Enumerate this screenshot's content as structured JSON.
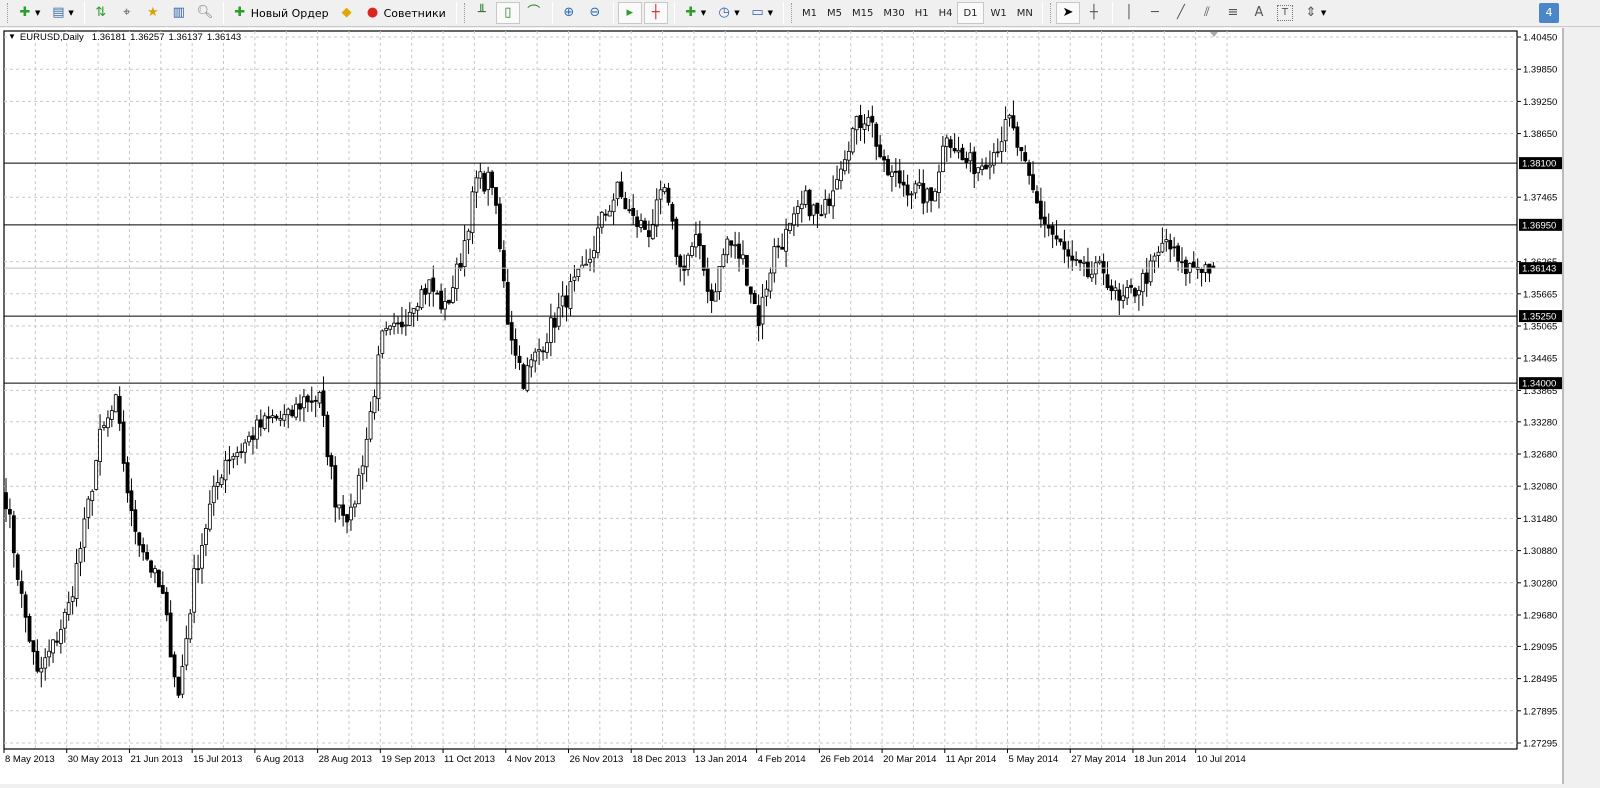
{
  "toolbar": {
    "new_order_label": "Новый Ордер",
    "experts_label": "Советники",
    "timeframes": [
      "M1",
      "M5",
      "M15",
      "M30",
      "H1",
      "H4",
      "D1",
      "W1",
      "MN"
    ],
    "active_timeframe": "D1",
    "notification_count": "4",
    "text_tool_label": "A"
  },
  "chart": {
    "symbol": "EURUSD,Daily",
    "open": "1.36181",
    "high": "1.36257",
    "low": "1.36137",
    "close": "1.36143",
    "bull_color": "#ffffff",
    "bear_color": "#000000",
    "outline_color": "#000000"
  },
  "chart_data": {
    "type": "candlestick",
    "price_ticks": [
      "1.40450",
      "1.39850",
      "1.39250",
      "1.38650",
      "1.37465",
      "1.36265",
      "1.35665",
      "1.35065",
      "1.34465",
      "1.33865",
      "1.33280",
      "1.32680",
      "1.32080",
      "1.31480",
      "1.30880",
      "1.30280",
      "1.29680",
      "1.29095",
      "1.28495",
      "1.27895",
      "1.27295"
    ],
    "ylim": [
      1.27295,
      1.4045
    ],
    "date_ticks": [
      "8 May 2013",
      "30 May 2013",
      "21 Jun 2013",
      "15 Jul 2013",
      "6 Aug 2013",
      "28 Aug 2013",
      "19 Sep 2013",
      "11 Oct 2013",
      "4 Nov 2013",
      "26 Nov 2013",
      "18 Dec 2013",
      "13 Jan 2014",
      "4 Feb 2014",
      "26 Feb 2014",
      "20 Mar 2014",
      "11 Apr 2014",
      "5 May 2014",
      "27 May 2014",
      "18 Jun 2014",
      "10 Jul 2014"
    ],
    "bars_between_date_ticks": 16,
    "approx_close_every_4_bars": [
      1.3186,
      1.2999,
      1.2853,
      1.2909,
      1.2983,
      1.313,
      1.3297,
      1.3362,
      1.3149,
      1.3075,
      1.2999,
      1.2816,
      1.3038,
      1.3168,
      1.326,
      1.3278,
      1.3315,
      1.3334,
      1.3334,
      1.3371,
      1.3371,
      1.3186,
      1.3149,
      1.3297,
      1.3482,
      1.35,
      1.3556,
      1.3583,
      1.3537,
      1.3629,
      1.3777,
      1.3777,
      1.3519,
      1.3408,
      1.3463,
      1.3519,
      1.3574,
      1.3611,
      1.3703,
      1.3759,
      1.3703,
      1.3685,
      1.3759,
      1.3611,
      1.3666,
      1.3556,
      1.3666,
      1.3629,
      1.3519,
      1.3648,
      1.3685,
      1.374,
      1.3703,
      1.3796,
      1.387,
      1.3907,
      1.3796,
      1.3777,
      1.3759,
      1.374,
      1.387,
      1.3814,
      1.3805,
      1.3833,
      1.3888,
      1.3796,
      1.3712,
      1.3666,
      1.362,
      1.3601,
      1.3611,
      1.3546,
      1.3574,
      1.3611,
      1.3666,
      1.3611,
      1.362,
      1.36143
    ],
    "horizontal_lines": [
      {
        "price": "1.38100",
        "color": "#000000"
      },
      {
        "price": "1.36950",
        "color": "#000000"
      },
      {
        "price": "1.36143",
        "color": "#c0c0c0",
        "label_kind": "bid"
      },
      {
        "price": "1.35250",
        "color": "#000000"
      },
      {
        "price": "1.34000",
        "color": "#000000"
      }
    ],
    "grid": true
  }
}
